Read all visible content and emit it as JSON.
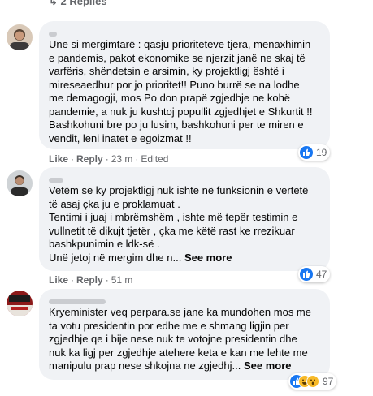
{
  "thread": {
    "replies_label": "2 Replies"
  },
  "comments": [
    {
      "lines": [
        "Une si mergimtarë : qasju prioriteteve tjera, menaxhimin",
        "e pandemis, pakot ekonomike se njerzit janë ne skaj të",
        "varfëris, shëndetsin e arsimin, ky projektligj është i",
        "mireseaedhur por jo prioritet!! Puno burrë se na lodhe",
        "me demagogji, mos Po don prapë zgjedhje ne kohë",
        "pandemie, a nuk ju kushtoj popullit zgjedhjet e Shkurtit !!",
        "Bashkohuni bre po ju lusim, bashkohuni per te miren e",
        "vendit, leni inatet e egoizmat !!"
      ],
      "like": "Like",
      "reply": "Reply",
      "time": "23 m",
      "edited": "Edited",
      "reaction_count": "19"
    },
    {
      "lines": [
        "Vetëm se ky projektligj nuk ishte në funksionin e vertetë",
        "të asaj çka ju e proklamuat .",
        "Tentimi i juaj i mbrëmshëm , ishte më tepër testimin e",
        "vullnetit të dikujt tjetër , çka me këtë rast ke rrezikuar",
        "bashkpunimin e ldk-së ."
      ],
      "last_line": "Unë jetoj në mergim dhe n...",
      "see_more": "See more",
      "like": "Like",
      "reply": "Reply",
      "time": "51 m",
      "reaction_count": "47"
    },
    {
      "lines": [
        "Kryeminister veq perpara.se jane ka mundohen mos me",
        "ta votu presidentin por edhe me e shmang ligjin per",
        "zgjedhje qe i bije nese nuk te votojne presidentin dhe",
        "nuk ka ligj per zgjedhje atehere keta e kan me lehte me"
      ],
      "last_line": "manipulu prap nese shkojna ne zgjedhj...",
      "see_more": "See more",
      "reaction_count": "97"
    }
  ],
  "colors": {
    "bubble": "#f0f2f5",
    "like_blue": "#1877f2",
    "meta_gray": "#65676b"
  },
  "icons": [
    "like-icon",
    "haha-icon",
    "wow-icon"
  ]
}
